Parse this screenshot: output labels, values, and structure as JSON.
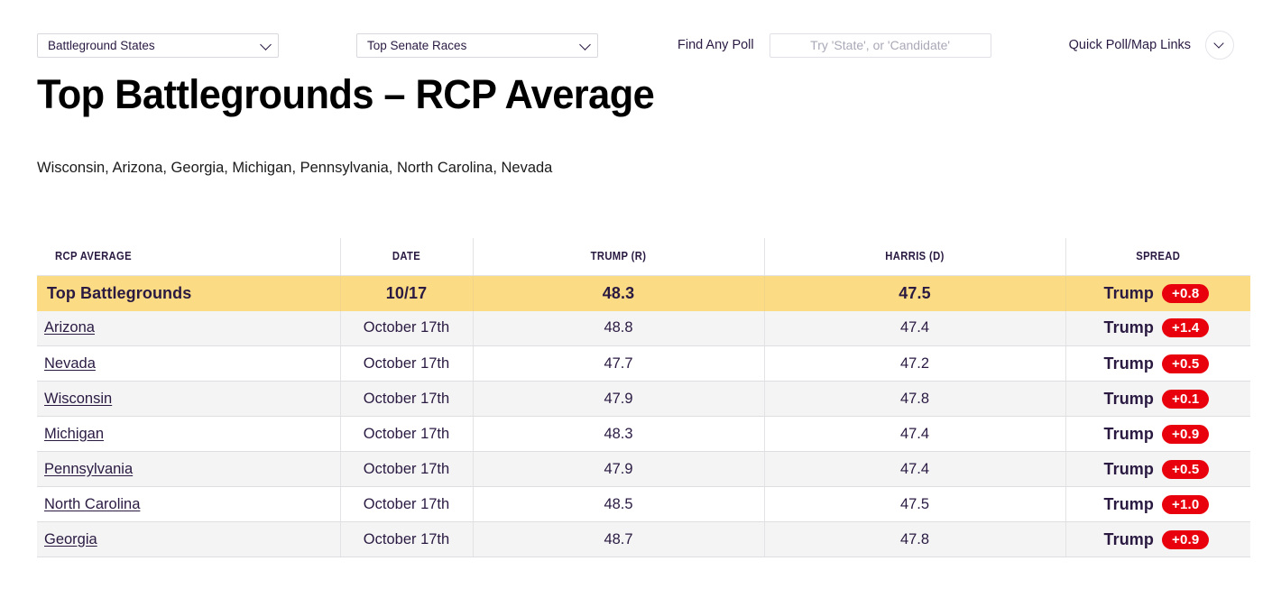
{
  "toolbar": {
    "state_select": {
      "value": "Battleground States",
      "icon": "chevron-down-icon"
    },
    "race_select": {
      "value": "Top Senate Races",
      "icon": "chevron-down-icon"
    },
    "find_label": "Find Any Poll",
    "search_placeholder": "Try 'State', or 'Candidate'",
    "search_value": "",
    "quick_links_label": "Quick Poll/Map Links",
    "expand_icon": "chevron-down-icon"
  },
  "header": {
    "title": "Top Battlegrounds – RCP Average",
    "subtitle": "Wisconsin, Arizona, Georgia, Michigan, Pennsylvania, North Carolina, Nevada"
  },
  "colors": {
    "summary_row": "#fbdb84",
    "badge_red": "#e8000d",
    "text": "#2a1a42",
    "alt_row": "#f4f4f4"
  },
  "table": {
    "columns": [
      "RCP AVERAGE",
      "DATE",
      "TRUMP (R)",
      "HARRIS (D)",
      "SPREAD"
    ],
    "summary": {
      "name": "Top Battlegrounds",
      "date": "10/17",
      "trump": "48.3",
      "harris": "47.5",
      "spread_leader": "Trump",
      "spread_value": "+0.8"
    },
    "rows": [
      {
        "name": "Arizona",
        "date": "October 17th",
        "trump": "48.8",
        "harris": "47.4",
        "spread_leader": "Trump",
        "spread_value": "+1.4"
      },
      {
        "name": "Nevada",
        "date": "October 17th",
        "trump": "47.7",
        "harris": "47.2",
        "spread_leader": "Trump",
        "spread_value": "+0.5"
      },
      {
        "name": "Wisconsin",
        "date": "October 17th",
        "trump": "47.9",
        "harris": "47.8",
        "spread_leader": "Trump",
        "spread_value": "+0.1"
      },
      {
        "name": "Michigan",
        "date": "October 17th",
        "trump": "48.3",
        "harris": "47.4",
        "spread_leader": "Trump",
        "spread_value": "+0.9"
      },
      {
        "name": "Pennsylvania",
        "date": "October 17th",
        "trump": "47.9",
        "harris": "47.4",
        "spread_leader": "Trump",
        "spread_value": "+0.5"
      },
      {
        "name": "North Carolina",
        "date": "October 17th",
        "trump": "48.5",
        "harris": "47.5",
        "spread_leader": "Trump",
        "spread_value": "+1.0"
      },
      {
        "name": "Georgia",
        "date": "October 17th",
        "trump": "48.7",
        "harris": "47.8",
        "spread_leader": "Trump",
        "spread_value": "+0.9"
      }
    ]
  }
}
